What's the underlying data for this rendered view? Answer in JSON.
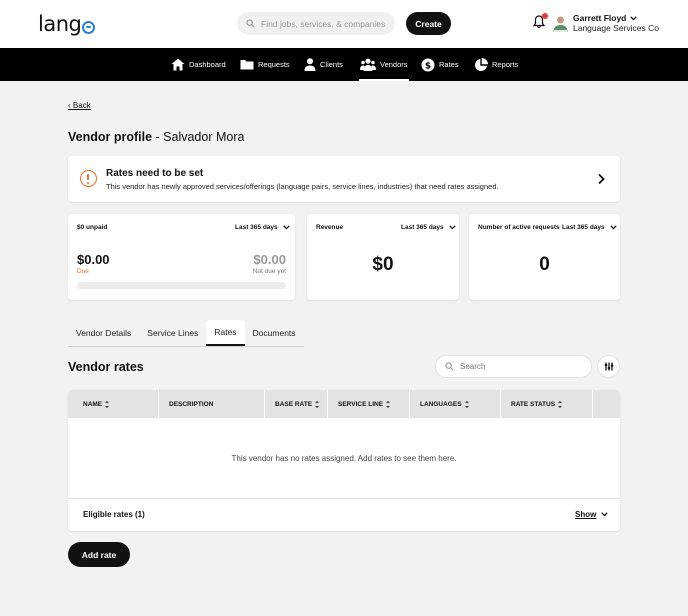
{
  "header": {
    "logo": "lang",
    "search_placeholder": "Find jobs, services, & companies",
    "create_label": "Create",
    "user_name": "Garrett Floyd",
    "user_org": "Language Services Co"
  },
  "nav": {
    "items": [
      {
        "label": "Dashboard",
        "icon": "home-icon"
      },
      {
        "label": "Requests",
        "icon": "folder-icon"
      },
      {
        "label": "Clients",
        "icon": "person-icon"
      },
      {
        "label": "Vendors",
        "icon": "group-icon",
        "active": true
      },
      {
        "label": "Rates",
        "icon": "dollar-icon"
      },
      {
        "label": "Reports",
        "icon": "pie-chart-icon"
      }
    ]
  },
  "back_label": "‹ Back",
  "page_title": {
    "prefix": "Vendor profile",
    "separator": " - ",
    "name": "Salvador Mora"
  },
  "alert": {
    "title": "Rates need to be set",
    "description": "This vendor has newly approved services/offerings (language pairs, service lines, industries) that need rates assigned.",
    "accent_color": "#e8702a"
  },
  "cards": {
    "unpaid": {
      "label": "$0 unpaid",
      "range": "Last 365 days",
      "due_value": "$0.00",
      "due_label": "Due",
      "not_due_value": "$0.00",
      "not_due_label": "Not due yet",
      "due_color": "#e8702a"
    },
    "revenue": {
      "label": "Revenue",
      "range": "Last 365 days",
      "value": "$0"
    },
    "active_requests": {
      "label": "Number of active requests",
      "range": "Last 365 days",
      "value": "0"
    }
  },
  "tabs": [
    {
      "label": "Vendor Details"
    },
    {
      "label": "Service Lines"
    },
    {
      "label": "Rates",
      "active": true
    },
    {
      "label": "Documents"
    }
  ],
  "vendor_rates": {
    "title": "Vendor rates",
    "search_placeholder": "Search",
    "columns": [
      "NAME",
      "DESCRIPTION",
      "BASE RATE",
      "SERVICE LINE",
      "LANGUAGES",
      "RATE STATUS"
    ],
    "empty_message": "This vendor has no rates assigned. Add rates to see them here.",
    "eligible_label": "Eligible rates (1)",
    "show_label": "Show"
  },
  "add_rate_label": "Add rate"
}
